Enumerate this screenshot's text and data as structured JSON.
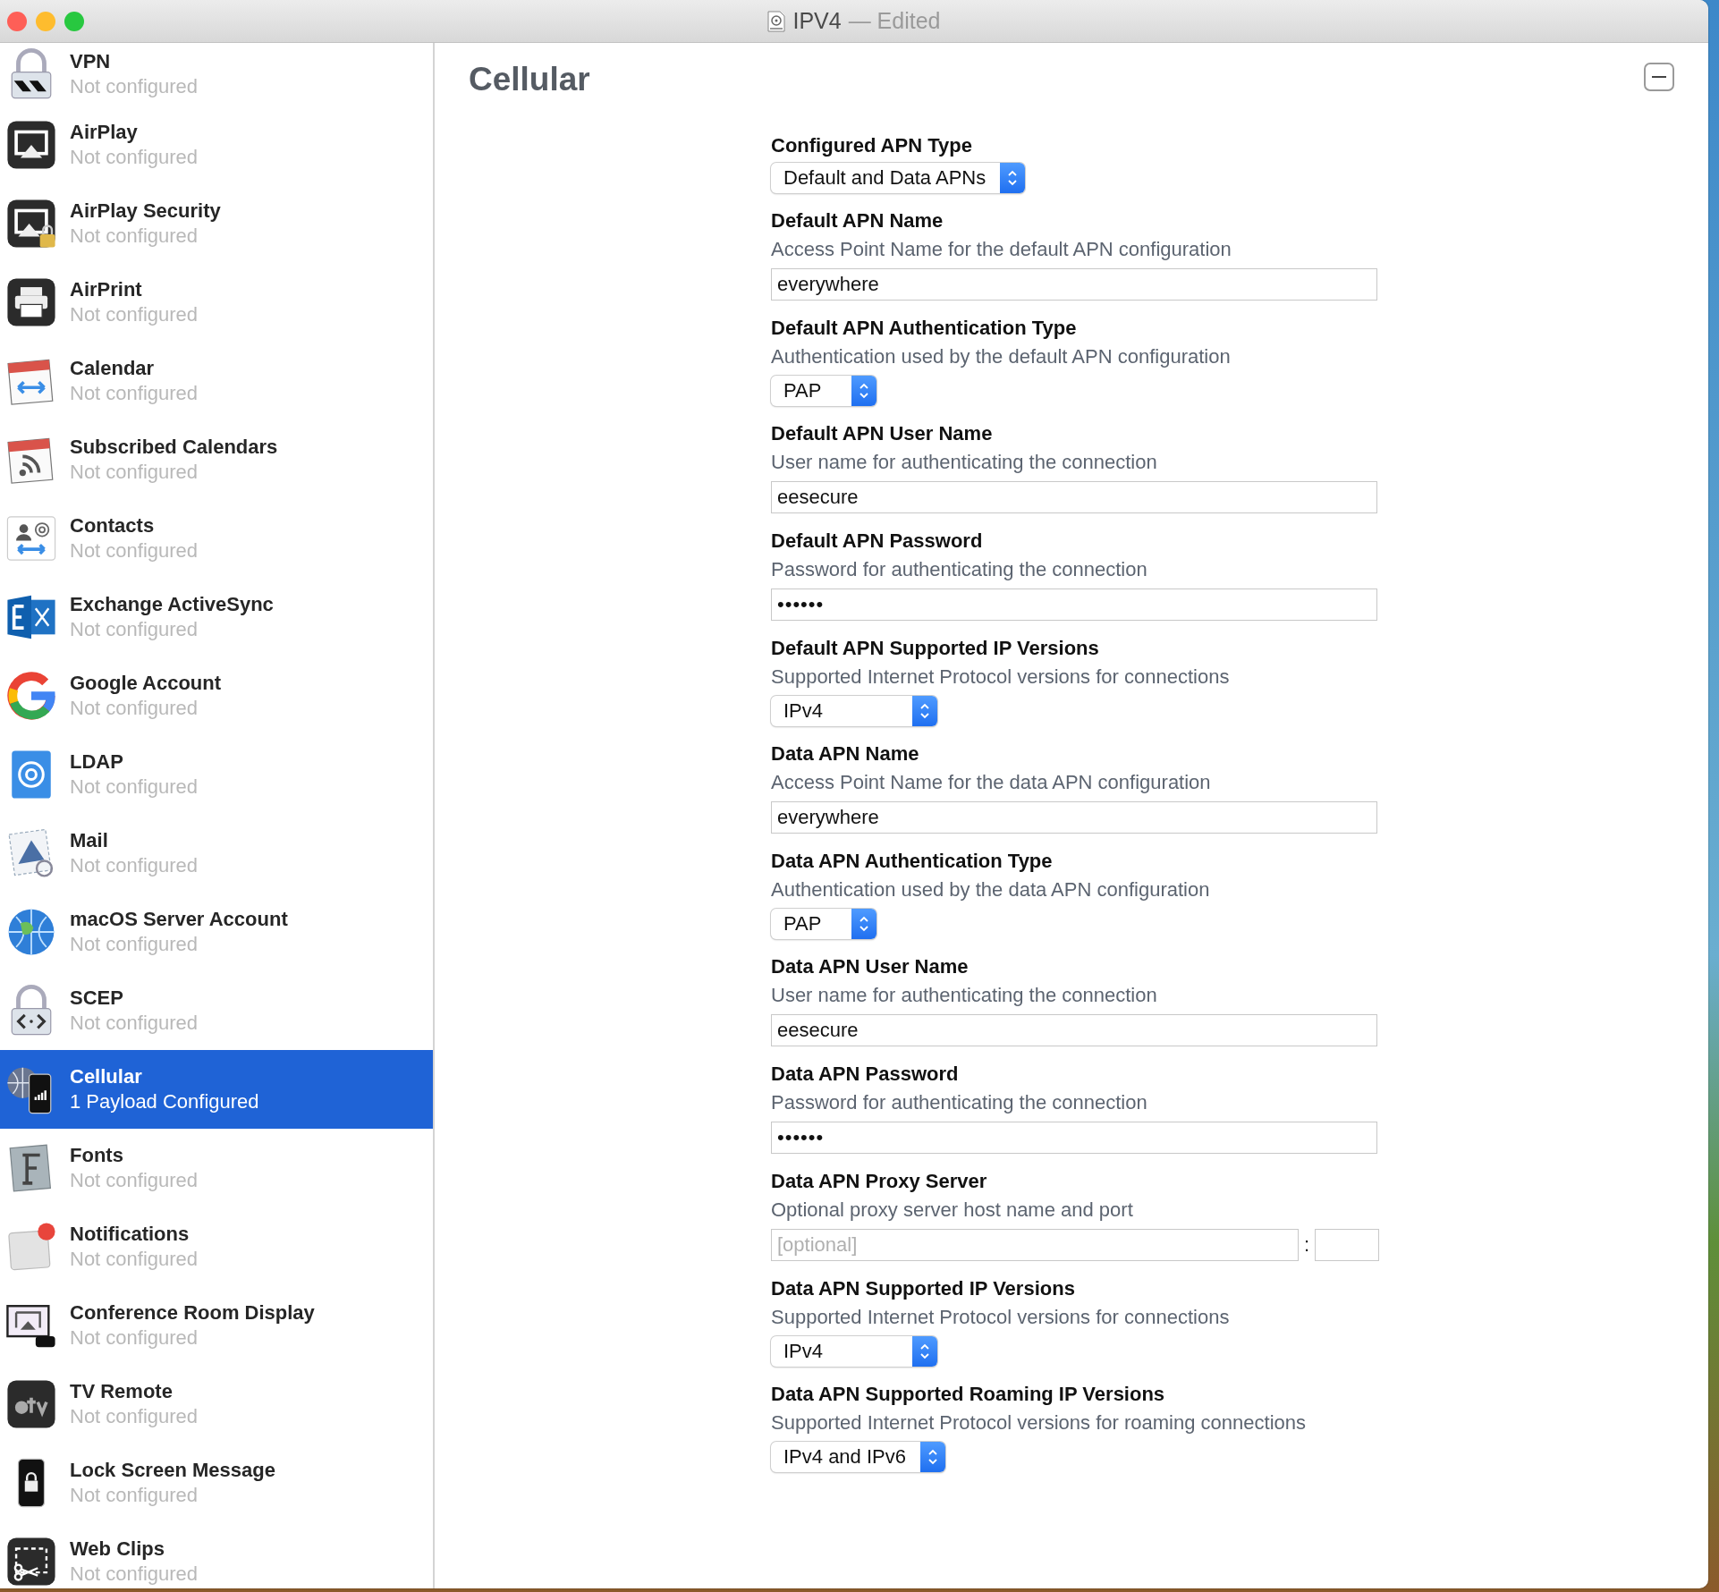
{
  "window": {
    "title": "IPV4",
    "edited_suffix": "— Edited"
  },
  "sidebar": {
    "items": [
      {
        "title": "VPN",
        "status": "Not configured",
        "selected": false
      },
      {
        "title": "AirPlay",
        "status": "Not configured",
        "selected": false
      },
      {
        "title": "AirPlay Security",
        "status": "Not configured",
        "selected": false
      },
      {
        "title": "AirPrint",
        "status": "Not configured",
        "selected": false
      },
      {
        "title": "Calendar",
        "status": "Not configured",
        "selected": false
      },
      {
        "title": "Subscribed Calendars",
        "status": "Not configured",
        "selected": false
      },
      {
        "title": "Contacts",
        "status": "Not configured",
        "selected": false
      },
      {
        "title": "Exchange ActiveSync",
        "status": "Not configured",
        "selected": false
      },
      {
        "title": "Google Account",
        "status": "Not configured",
        "selected": false
      },
      {
        "title": "LDAP",
        "status": "Not configured",
        "selected": false
      },
      {
        "title": "Mail",
        "status": "Not configured",
        "selected": false
      },
      {
        "title": "macOS Server Account",
        "status": "Not configured",
        "selected": false
      },
      {
        "title": "SCEP",
        "status": "Not configured",
        "selected": false
      },
      {
        "title": "Cellular",
        "status": "1 Payload Configured",
        "selected": true
      },
      {
        "title": "Fonts",
        "status": "Not configured",
        "selected": false
      },
      {
        "title": "Notifications",
        "status": "Not configured",
        "selected": false
      },
      {
        "title": "Conference Room Display",
        "status": "Not configured",
        "selected": false
      },
      {
        "title": "TV Remote",
        "status": "Not configured",
        "selected": false
      },
      {
        "title": "Lock Screen Message",
        "status": "Not configured",
        "selected": false
      },
      {
        "title": "Web Clips",
        "status": "Not configured",
        "selected": false
      }
    ]
  },
  "content": {
    "heading": "Cellular",
    "fields": [
      {
        "kind": "select",
        "label": "Configured APN Type",
        "value": "Default and Data APNs"
      },
      {
        "kind": "text",
        "label": "Default APN Name",
        "description": "Access Point Name for the default APN configuration",
        "value": "everywhere"
      },
      {
        "kind": "select",
        "label": "Default APN Authentication Type",
        "description": "Authentication used by the default APN configuration",
        "value": "PAP"
      },
      {
        "kind": "text",
        "label": "Default APN User Name",
        "description": "User name for authenticating the connection",
        "value": "eesecure"
      },
      {
        "kind": "password",
        "label": "Default APN Password",
        "description": "Password for authenticating the connection",
        "value": "••••••"
      },
      {
        "kind": "select",
        "label": "Default APN Supported IP Versions",
        "description": "Supported Internet Protocol versions for connections",
        "value": "IPv4"
      },
      {
        "kind": "text",
        "label": "Data APN Name",
        "description": "Access Point Name for the data APN configuration",
        "value": "everywhere"
      },
      {
        "kind": "select",
        "label": "Data APN Authentication Type",
        "description": "Authentication used by the data APN configuration",
        "value": "PAP"
      },
      {
        "kind": "text",
        "label": "Data APN User Name",
        "description": "User name for authenticating the connection",
        "value": "eesecure"
      },
      {
        "kind": "password",
        "label": "Data APN Password",
        "description": "Password for authenticating the connection",
        "value": "••••••"
      },
      {
        "kind": "proxy",
        "label": "Data APN Proxy Server",
        "description": "Optional proxy server host name and port",
        "placeholder": "[optional]",
        "separator": ":"
      },
      {
        "kind": "select",
        "label": "Data APN Supported IP Versions",
        "description": "Supported Internet Protocol versions for connections",
        "value": "IPv4"
      },
      {
        "kind": "select",
        "label": "Data APN Supported Roaming IP Versions",
        "description": "Supported Internet Protocol versions for roaming connections",
        "value": "IPv4 and IPv6"
      }
    ]
  }
}
